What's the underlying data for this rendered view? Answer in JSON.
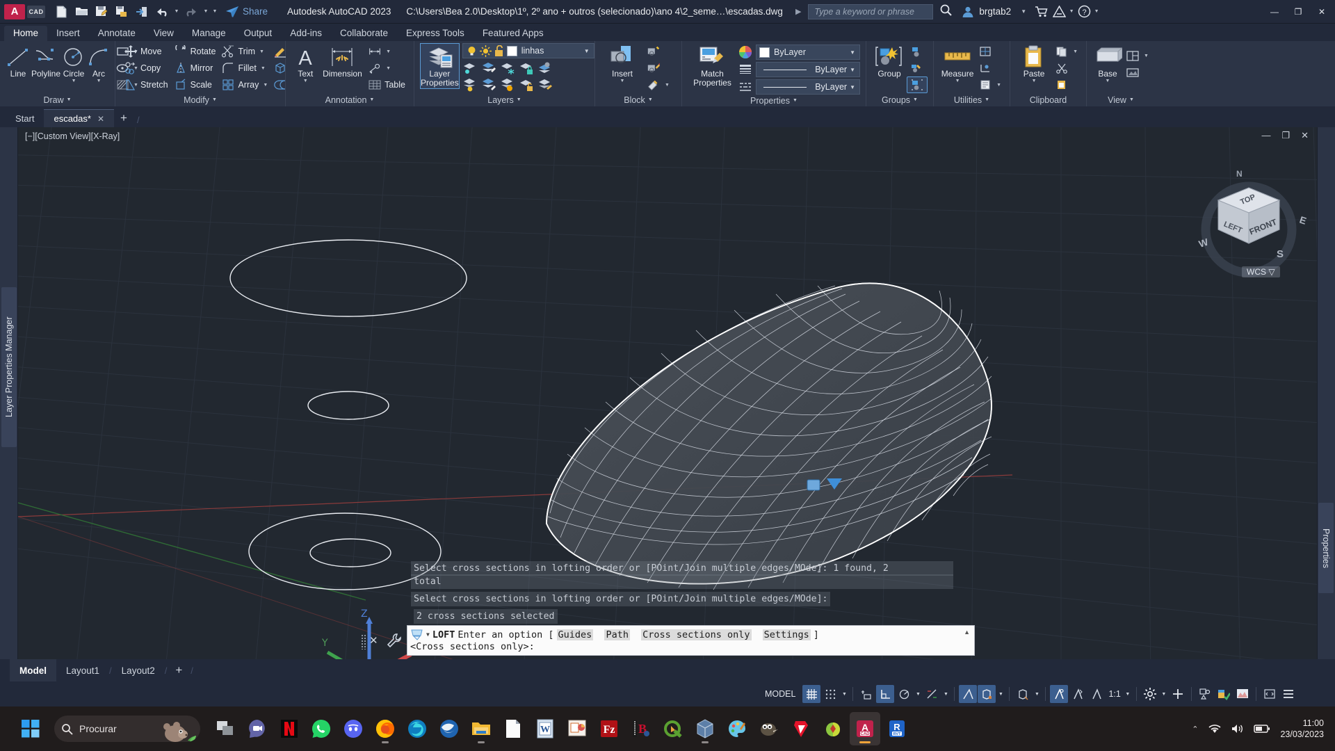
{
  "titlebar": {
    "app_icon": "autocad-a-icon",
    "cad_badge": "CAD",
    "quick_access": [
      {
        "name": "new-file-icon",
        "label": "New"
      },
      {
        "name": "open-folder-icon",
        "label": "Open"
      },
      {
        "name": "save-icon",
        "label": "Save"
      },
      {
        "name": "save-as-icon",
        "label": "Save As"
      },
      {
        "name": "export-icon",
        "label": "Export"
      },
      {
        "name": "undo-icon",
        "label": "Undo"
      },
      {
        "name": "redo-icon",
        "label": "Redo"
      },
      {
        "name": "qat-more-icon",
        "label": "Customize Quick Access Toolbar"
      }
    ],
    "share_label": "Share",
    "app_title": "Autodesk AutoCAD 2023",
    "file_path": "C:\\Users\\Bea 2.0\\Desktop\\1º, 2º ano + outros (selecionado)\\ano 4\\2_seme…\\escadas.dwg",
    "search_placeholder": "Type a keyword or phrase",
    "user_name": "brgtab2",
    "window_buttons": [
      "minimize",
      "restore",
      "close"
    ]
  },
  "ribbon": {
    "tabs": [
      {
        "label": "Home",
        "active": true
      },
      {
        "label": "Insert",
        "active": false
      },
      {
        "label": "Annotate",
        "active": false
      },
      {
        "label": "View",
        "active": false
      },
      {
        "label": "Manage",
        "active": false
      },
      {
        "label": "Output",
        "active": false
      },
      {
        "label": "Add-ins",
        "active": false
      },
      {
        "label": "Collaborate",
        "active": false
      },
      {
        "label": "Express Tools",
        "active": false
      },
      {
        "label": "Featured Apps",
        "active": false
      }
    ],
    "panels": {
      "draw": {
        "title": "Draw",
        "big": [
          {
            "label": "Line",
            "icon": "line-icon",
            "dropdown": false
          },
          {
            "label": "Polyline",
            "icon": "polyline-icon",
            "dropdown": false
          },
          {
            "label": "Circle",
            "icon": "circle-icon",
            "dropdown": true
          },
          {
            "label": "Arc",
            "icon": "arc-icon",
            "dropdown": true
          }
        ],
        "small": [
          {
            "icon": "rectangle-icon",
            "label": ""
          },
          {
            "icon": "ellipse-icon",
            "label": ""
          },
          {
            "icon": "hatch-icon",
            "label": ""
          }
        ]
      },
      "modify": {
        "title": "Modify",
        "items": [
          {
            "label": "Move",
            "icon": "move-icon"
          },
          {
            "label": "Rotate",
            "icon": "rotate-icon"
          },
          {
            "label": "Trim",
            "icon": "trim-icon",
            "dropdown": true
          },
          {
            "label": "Copy",
            "icon": "copy-icon"
          },
          {
            "label": "Mirror",
            "icon": "mirror-icon"
          },
          {
            "label": "Fillet",
            "icon": "fillet-icon",
            "dropdown": true
          },
          {
            "label": "Stretch",
            "icon": "stretch-icon"
          },
          {
            "label": "Scale",
            "icon": "scale-icon"
          },
          {
            "label": "Array",
            "icon": "array-icon",
            "dropdown": true
          }
        ],
        "extra": [
          {
            "icon": "erase-brush-icon"
          },
          {
            "icon": "3d-box-icon"
          },
          {
            "icon": "offset-icon"
          }
        ]
      },
      "annotation": {
        "title": "Annotation",
        "big": [
          {
            "label": "Text",
            "icon": "text-a-icon",
            "dropdown": true
          },
          {
            "label": "Dimension",
            "icon": "dimension-icon",
            "dropdown": false
          }
        ],
        "small": [
          {
            "icon": "linear-dimension-icon",
            "label": ""
          },
          {
            "icon": "leader-icon",
            "label": ""
          },
          {
            "icon": "table-icon",
            "label": "Table"
          }
        ]
      },
      "layers": {
        "title": "Layers",
        "main_button": "Layer Properties",
        "current_layer": "linhas",
        "layer_state_icons": [
          "layer-on-bulb-icon",
          "layer-thaw-sun-icon",
          "layer-unlock-icon",
          "layer-color-swatch"
        ],
        "tool_icons": [
          "layer-isolate-icon",
          "layer-unisolate-icon",
          "layer-freeze-icon",
          "layer-lock-icon",
          "layer-make-current-icon",
          "layer-off-icon",
          "layer-match-icon",
          "layer-previous-icon",
          "layer-unlock-obj-icon",
          "layer-merge-icon"
        ]
      },
      "block": {
        "title": "Block",
        "main_button": "Insert",
        "tool_icons": [
          "create-block-icon",
          "edit-block-icon",
          "block-attributes-icon"
        ]
      },
      "properties": {
        "title": "Properties",
        "main_button": "Match Properties",
        "color_value": "ByLayer",
        "lineweight_value": "ByLayer",
        "linetype_value": "ByLayer",
        "color_swatch": "#ffffff"
      },
      "groups": {
        "title": "Groups",
        "main_button": "Group",
        "tool_icons": [
          "ungroup-icon",
          "group-edit-icon",
          "group-selection-icon"
        ]
      },
      "utilities": {
        "title": "Utilities",
        "main_button": "Measure",
        "tool_icons": [
          "quick-measure-icon",
          "id-point-icon",
          "list-icon"
        ]
      },
      "clipboard": {
        "title": "Clipboard",
        "main_button": "Paste",
        "tool_icons": [
          "copy-clip-icon",
          "cut-clip-icon",
          "paste-special-icon"
        ]
      },
      "view": {
        "title": "View",
        "main_button": "Base",
        "tool_icons": [
          "viewport-config-icon",
          "named-views-icon"
        ]
      }
    }
  },
  "file_tabs": {
    "start_label": "Start",
    "tabs": [
      {
        "label": "escadas*",
        "active": true,
        "close": "✕"
      }
    ],
    "new_tab": "+"
  },
  "viewport": {
    "label": "[−][Custom View][X-Ray]",
    "left_rail_label": "Layer Properties Manager",
    "right_rail_label": "Properties",
    "viewcube": {
      "top": "TOP",
      "left": "LEFT",
      "front": "FRONT",
      "n": "N",
      "e": "E",
      "s": "S",
      "w": "W"
    },
    "wcs_label": "WCS",
    "window_buttons": [
      "minimize",
      "restore",
      "close"
    ]
  },
  "dynamic_prompts": [
    "Select cross sections in lofting order or [POint/Join multiple edges/MOde]: 1 found, 2",
    "total",
    "Select cross sections in lofting order or [POint/Join multiple edges/MOde]:",
    "2 cross sections selected"
  ],
  "command_line": {
    "command_name": "LOFT",
    "prompt_prefix": "Enter an option [",
    "options": [
      "Guides",
      "Path",
      "Cross sections only",
      "Settings"
    ],
    "prompt_suffix": "]",
    "default_line": "<Cross sections only>:"
  },
  "layout_tabs": {
    "tabs": [
      {
        "label": "Model",
        "active": true
      },
      {
        "label": "Layout1",
        "active": false
      },
      {
        "label": "Layout2",
        "active": false
      }
    ],
    "add_label": "+"
  },
  "status_bar": {
    "space_label": "MODEL",
    "scale_value": "1:1",
    "toggles": [
      {
        "name": "grid-display-toggle",
        "on": true
      },
      {
        "name": "snap-mode-toggle",
        "on": false
      },
      {
        "name": "infer-constraints-toggle",
        "on": false
      },
      {
        "name": "ortho-mode-toggle",
        "on": true
      },
      {
        "name": "polar-tracking-toggle",
        "on": false
      },
      {
        "name": "isometric-drafting-toggle",
        "on": false
      },
      {
        "name": "object-snap-toggle",
        "on": true
      },
      {
        "name": "3d-object-snap-toggle",
        "on": false
      },
      {
        "name": "object-snap-tracking-toggle",
        "on": false
      },
      {
        "name": "dynamic-ucs-toggle",
        "on": true
      },
      {
        "name": "selection-cycling-toggle",
        "on": false
      },
      {
        "name": "annotation-visibility-toggle",
        "on": false
      },
      {
        "name": "workspace-settings-icon",
        "on": false
      },
      {
        "name": "hardware-acceleration-icon",
        "on": false
      },
      {
        "name": "isolate-objects-icon",
        "on": false
      },
      {
        "name": "clean-screen-icon",
        "on": false
      },
      {
        "name": "customization-menu-icon",
        "on": false
      }
    ]
  },
  "taskbar": {
    "start_icon": "windows-start-icon",
    "search_placeholder": "Procurar",
    "apps": [
      {
        "name": "task-view-icon"
      },
      {
        "name": "microsoft-teams-icon"
      },
      {
        "name": "netflix-icon"
      },
      {
        "name": "whatsapp-icon"
      },
      {
        "name": "discord-icon"
      },
      {
        "name": "firefox-icon",
        "running": true
      },
      {
        "name": "microsoft-edge-icon"
      },
      {
        "name": "thunderbird-icon"
      },
      {
        "name": "file-explorer-icon",
        "running": true
      },
      {
        "name": "notepad-icon"
      },
      {
        "name": "microsoft-word-icon"
      },
      {
        "name": "microsoft-powerpoint-icon"
      },
      {
        "name": "filezilla-icon"
      },
      {
        "name": "bluebeam-revu-icon"
      },
      {
        "name": "qgis-icon"
      },
      {
        "name": "sketchup-viewer-icon",
        "running": true
      },
      {
        "name": "paint-icon"
      },
      {
        "name": "gimp-icon"
      },
      {
        "name": "sketchup-icon"
      },
      {
        "name": "lumion-icon"
      },
      {
        "name": "autocad-icon",
        "active": true
      },
      {
        "name": "revit-icon"
      }
    ],
    "tray": [
      "show-hidden-icons-chevron",
      "wifi-icon",
      "volume-icon",
      "battery-icon"
    ],
    "clock_time": "11:00",
    "clock_date": "23/03/2023"
  },
  "colors": {
    "accent_blue": "#5b9bd5",
    "titlebar_bg": "#22293a",
    "ribbon_bg": "#2c3446",
    "canvas_bg": "#222830",
    "command_bg": "#fbfbfb",
    "taskbar_bg": "#201c1c"
  }
}
